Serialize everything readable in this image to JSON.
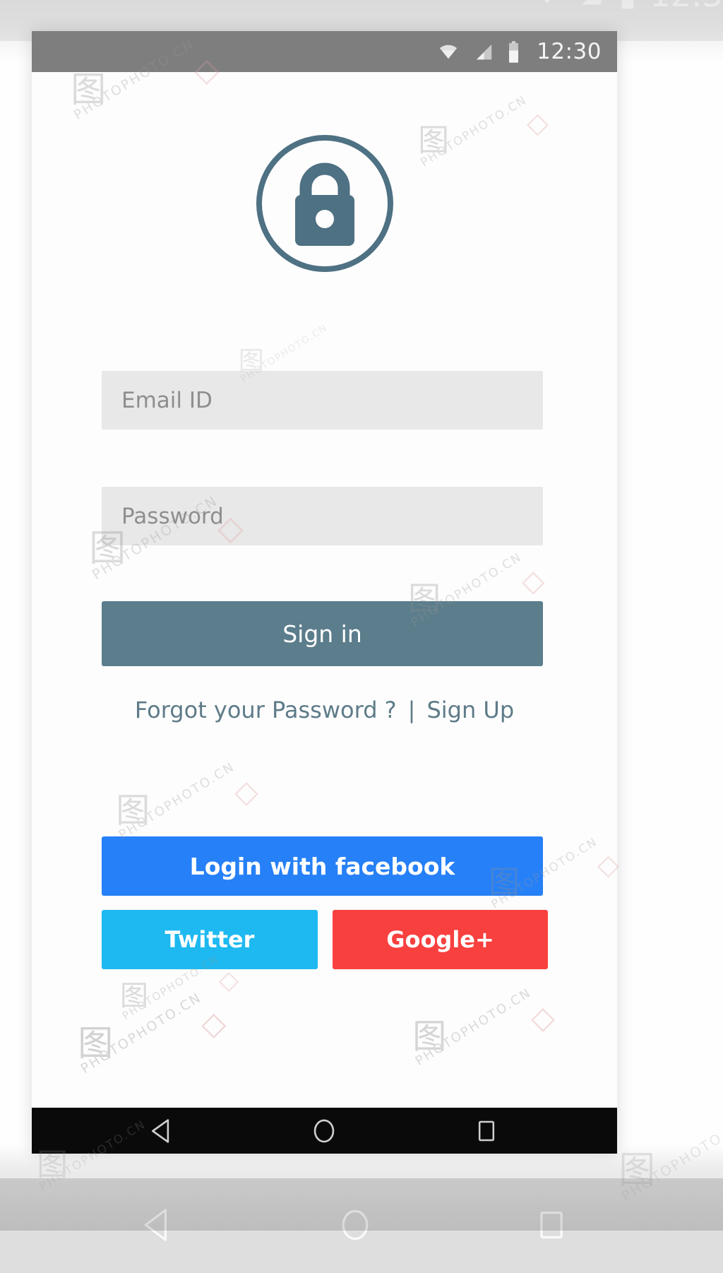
{
  "screen": {
    "background_color": "#fdfdfd",
    "accent_color": "#5b7d8c"
  },
  "statusbar": {
    "background_color": "#7e7e7e",
    "clock": "12:30",
    "icons": [
      {
        "name": "wifi-icon",
        "label": "wifi"
      },
      {
        "name": "cellular-signal-icon",
        "label": "signal"
      },
      {
        "name": "battery-icon",
        "label": "battery"
      }
    ]
  },
  "logo": {
    "icon_name": "lock-icon",
    "color": "#4e7183",
    "circle_stroke": "#4e7183"
  },
  "form": {
    "email": {
      "placeholder": "Email ID",
      "value": ""
    },
    "password": {
      "placeholder": "Password",
      "value": ""
    },
    "signin_label": "Sign in"
  },
  "links": {
    "forgot_password": "Forgot your Password ?",
    "separator": "|",
    "sign_up": "Sign Up"
  },
  "social": {
    "facebook": {
      "label": "Login with facebook",
      "color": "#2680f7"
    },
    "twitter": {
      "label": "Twitter",
      "color": "#1eb9f0"
    },
    "googleplus": {
      "label": "Google+",
      "color": "#f8403f"
    }
  },
  "navbar": {
    "background_color": "#0a0a0a",
    "buttons": [
      {
        "name": "nav-back-button",
        "label": "Back"
      },
      {
        "name": "nav-home-button",
        "label": "Home"
      },
      {
        "name": "nav-recents-button",
        "label": "Recents"
      }
    ]
  },
  "watermarks": {
    "mark": "图",
    "text": "PHOTOPHOTO.CN"
  }
}
